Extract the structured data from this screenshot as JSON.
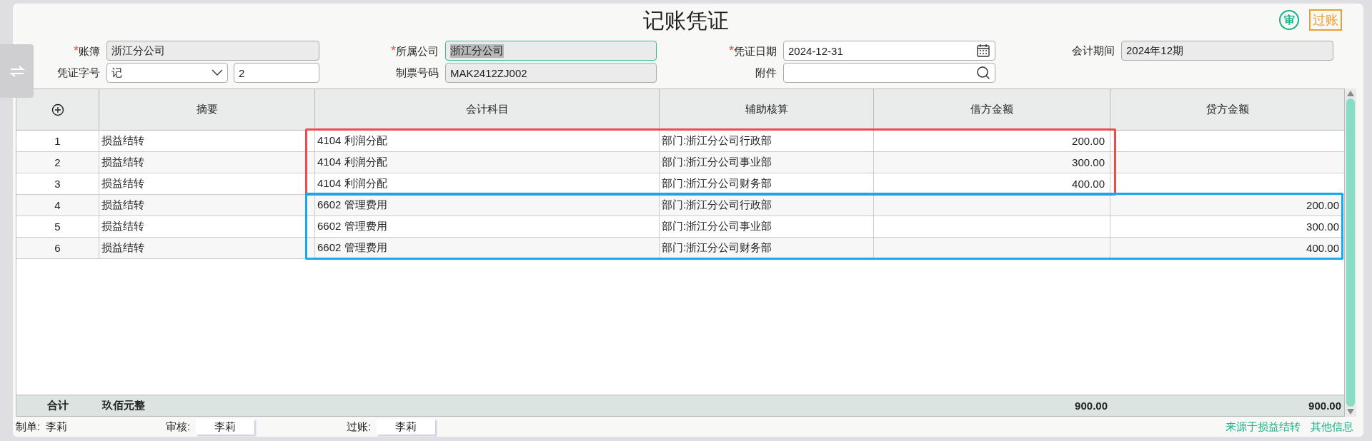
{
  "title": "记账凭证",
  "actions": [
    {
      "kind": "circle",
      "label": "审"
    },
    {
      "kind": "boxed",
      "label": "过账"
    }
  ],
  "form_rows": [
    [
      {
        "label": "账簿",
        "required_mark": "*",
        "kind": "text",
        "value": "浙江分公司",
        "readonly": true,
        "focused": false
      },
      {
        "label": "所属公司",
        "required_mark": "*",
        "kind": "text",
        "value": "浙江分公司",
        "readonly": true,
        "focused": true
      },
      {
        "label": "凭证日期",
        "required_mark": "*",
        "kind": "date",
        "value": "2024-12-31",
        "readonly": false,
        "focused": false
      },
      {
        "label": "会计期间",
        "kind": "text",
        "value": "2024年12期",
        "readonly": true,
        "focused": false
      }
    ],
    [
      {
        "label": "凭证字号",
        "kind": "select",
        "value": "记",
        "extra_value": "2",
        "readonly": false,
        "focused": false
      },
      {
        "label": "制票号码",
        "kind": "text",
        "value": "MAK2412ZJ002",
        "readonly": true,
        "focused": false
      },
      {
        "label": "附件",
        "kind": "search",
        "readonly": false,
        "focused": false
      },
      null
    ]
  ],
  "table": {
    "columns": [
      "摘要",
      "会计科目",
      "辅助核算",
      "借方金额",
      "贷方金额"
    ],
    "rows": [
      {
        "no": "1",
        "summary": "损益结转",
        "subject": "4104 利润分配",
        "auxiliary": "部门:浙江分公司行政部",
        "debit": "200.00",
        "credit": "",
        "color": "#ef4b4b"
      },
      {
        "no": "2",
        "summary": "损益结转",
        "subject": "4104 利润分配",
        "auxiliary": "部门:浙江分公司事业部",
        "debit": "300.00",
        "credit": "",
        "color": "#ef4b4b"
      },
      {
        "no": "3",
        "summary": "损益结转",
        "subject": "4104 利润分配",
        "auxiliary": "部门:浙江分公司财务部",
        "debit": "400.00",
        "credit": "",
        "color": "#ef4b4b"
      },
      {
        "no": "4",
        "summary": "损益结转",
        "subject": "6602 管理费用",
        "auxiliary": "部门:浙江分公司行政部",
        "debit": "",
        "credit": "200.00",
        "color": "#1aa7f0"
      },
      {
        "no": "5",
        "summary": "损益结转",
        "subject": "6602 管理费用",
        "auxiliary": "部门:浙江分公司事业部",
        "debit": "",
        "credit": "300.00",
        "color": "#1aa7f0"
      },
      {
        "no": "6",
        "summary": "损益结转",
        "subject": "6602 管理费用",
        "auxiliary": "部门:浙江分公司财务部",
        "debit": "",
        "credit": "400.00",
        "color": "#1aa7f0"
      }
    ],
    "total": {
      "label": "合计",
      "in_words": "玖佰元整",
      "debit": "900.00",
      "credit": "900.00"
    }
  },
  "footer": {
    "signers": [
      {
        "label": "制单:",
        "name": "李莉",
        "kind": "plain"
      },
      {
        "label": "审核:",
        "name": "李莉",
        "kind": "boxed"
      },
      {
        "label": "过账:",
        "name": "李莉",
        "kind": "boxed"
      }
    ],
    "links": [
      "来源于损益结转",
      "其他信息"
    ]
  }
}
